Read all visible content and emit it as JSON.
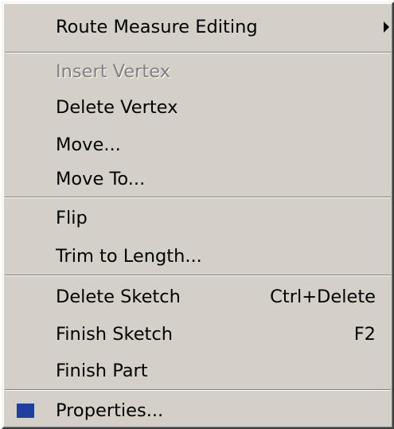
{
  "context_menu": {
    "items": [
      {
        "label": "Route Measure Editing",
        "has_submenu": true
      },
      {
        "label": "Insert Vertex",
        "disabled": true
      },
      {
        "label": "Delete Vertex"
      },
      {
        "label": "Move..."
      },
      {
        "label": "Move To..."
      },
      {
        "label": "Flip"
      },
      {
        "label": "Trim to Length..."
      },
      {
        "label": "Delete Sketch",
        "shortcut": "Ctrl+Delete"
      },
      {
        "label": "Finish Sketch",
        "shortcut": "F2"
      },
      {
        "label": "Finish Part"
      },
      {
        "label": "Properties...",
        "icon": "properties-icon"
      }
    ]
  },
  "colors": {
    "menu_background": "#d4d0c8",
    "disabled_text": "#808080",
    "icon_frame": "#1f3f9f"
  }
}
